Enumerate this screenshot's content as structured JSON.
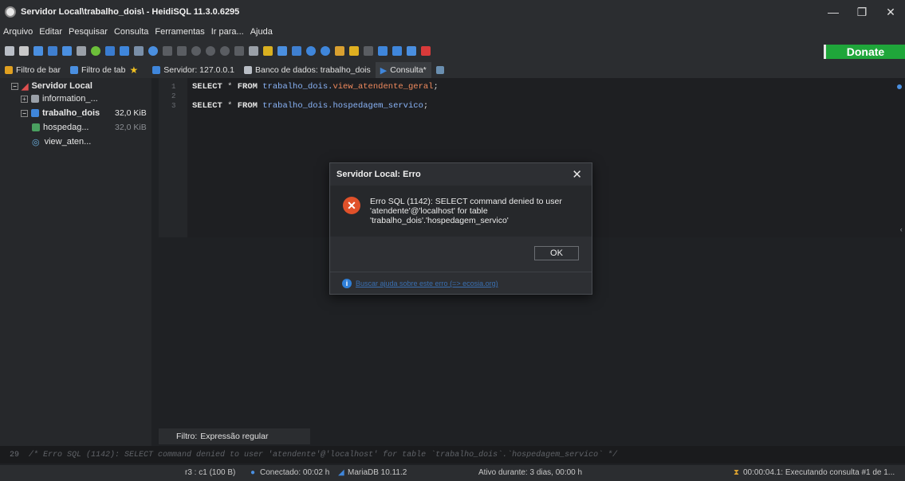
{
  "window": {
    "title": "Servidor Local\\trabalho_dois\\ - HeidiSQL 11.3.0.6295",
    "minimize": "—",
    "maximize": "❐",
    "close": "✕"
  },
  "menu": [
    "Arquivo",
    "Editar",
    "Pesquisar",
    "Consulta",
    "Ferramentas",
    "Ir para...",
    "Ajuda"
  ],
  "donate_label": "Donate",
  "tabs": {
    "filter_bar": "Filtro de bar",
    "filter_tab": "Filtro de tab",
    "server": "Servidor: 127.0.0.1",
    "database": "Banco de dados: trabalho_dois",
    "query": "Consulta*"
  },
  "tree": {
    "root": "Servidor Local",
    "items": [
      {
        "label": "information_...",
        "size": ""
      },
      {
        "label": "trabalho_dois",
        "size": "32,0 KiB"
      },
      {
        "label": "hospedag...",
        "size": "32,0 KiB"
      },
      {
        "label": "view_aten...",
        "size": ""
      }
    ]
  },
  "editor": {
    "line_numbers": [
      "1",
      "2",
      "3"
    ],
    "line1": {
      "kw1": "SELECT",
      "star": " * ",
      "kw2": "FROM",
      "schema": " trabalho_dois.",
      "obj": "view_atendente_geral",
      "end": ";"
    },
    "line3": {
      "kw1": "SELECT",
      "star": " * ",
      "kw2": "FROM",
      "schema": " trabalho_dois.hospedagem_servico",
      "end": ";"
    }
  },
  "filter": {
    "label": "Filtro:",
    "placeholder": "Expressão regular"
  },
  "log": {
    "line_number": "29",
    "text": "/* Erro SQL (1142): SELECT command denied to user 'atendente'@'localhost' for table `trabalho_dois`.`hospedagem_servico` */"
  },
  "status": {
    "position": "r3 : c1 (100 B)",
    "connected": "Conectado: 00:02 h",
    "server": "MariaDB 10.11.2",
    "uptime": "Ativo durante: 3 dias, 00:00 h",
    "query": "00:00:04.1: Executando consulta #1 de 1..."
  },
  "dialog": {
    "title": "Servidor Local: Erro",
    "close": "✕",
    "icon": "✕",
    "message_line1": "Erro SQL (1142): SELECT command denied to user",
    "message_line2": "'atendente'@'localhost' for table",
    "message_line3": "'trabalho_dois'.'hospedagem_servico'",
    "ok_label": "OK",
    "help_link": "Buscar ajuda sobre este erro (=> ecosia.org)",
    "info_icon": "i"
  },
  "colors": {
    "accent": "#2f7fd8",
    "error": "#e0512a",
    "donate": "#1fa63a"
  }
}
